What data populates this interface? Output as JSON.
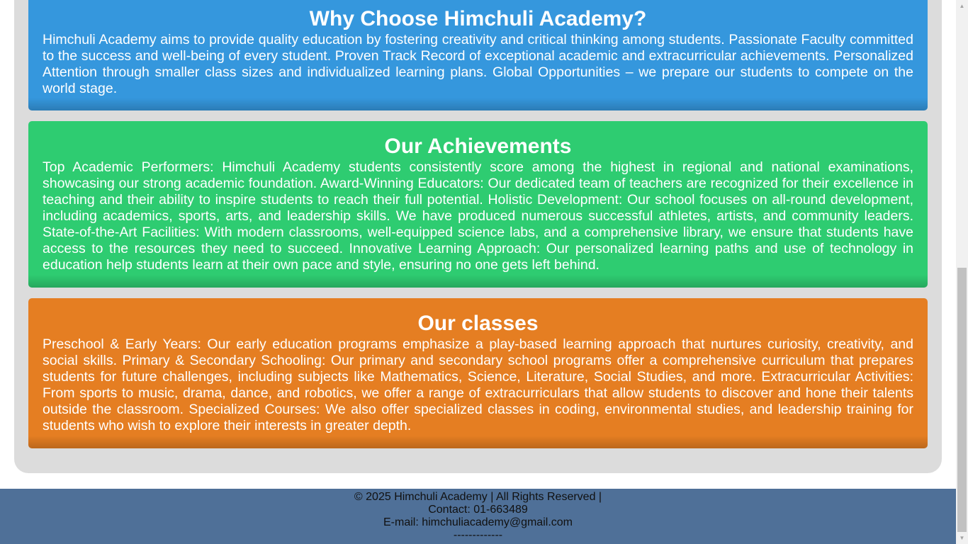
{
  "sections": [
    {
      "title": "Why Choose Himchuli Academy?",
      "body": "Himchuli Academy aims to provide quality education by fostering creativity and critical thinking among students. Passionate Faculty committed to the success and well-being of every student. Proven Track Record of exceptional academic and extracurricular achievements. Personalized Attention through smaller class sizes and individualized learning plans. Global Opportunities – we prepare our students to compete on the world stage.",
      "color": "#3597dd"
    },
    {
      "title": "Our Achievements",
      "body": "Top Academic Performers: Himchuli Academy students consistently score among the highest in regional and national examinations, showcasing our strong academic foundation. Award-Winning Educators: Our dedicated team of teachers are recognized for their excellence in teaching and their ability to inspire students to reach their full potential. Holistic Development: Our school focuses on all-round development, including academics, sports, arts, and leadership skills. We have produced numerous successful athletes, artists, and community leaders. State-of-the-Art Facilities: With modern classrooms, well-equipped science labs, and a comprehensive library, we ensure that students have access to the resources they need to succeed. Innovative Learning Approach: Our personalized learning paths and use of technology in education help students learn at their own pace and style, ensuring no one gets left behind.",
      "color": "#2ecc71"
    },
    {
      "title": "Our classes",
      "body": "Preschool & Early Years: Our early education programs emphasize a play-based learning approach that nurtures curiosity, creativity, and social skills. Primary & Secondary Schooling: Our primary and secondary school programs offer a comprehensive curriculum that prepares students for future challenges, including subjects like Mathematics, Science, Literature, Social Studies, and more. Extracurricular Activities: From sports to music, drama, dance, and robotics, we offer a range of extracurriculars that allow students to discover and hone their talents outside the classroom. Specialized Courses: We also offer specialized classes in coding, environmental studies, and leadership training for students who wish to explore their interests in greater depth.",
      "color": "#e57e22"
    }
  ],
  "footer": {
    "copyright": "© 2025 Himchuli Academy | All Rights Reserved |",
    "contact": "Contact: 01-663489",
    "email": "E-mail: himchuliacademy@gmail.com",
    "divider": "-------------",
    "background": "#4f7098"
  },
  "container_color": "#dcdcdc"
}
